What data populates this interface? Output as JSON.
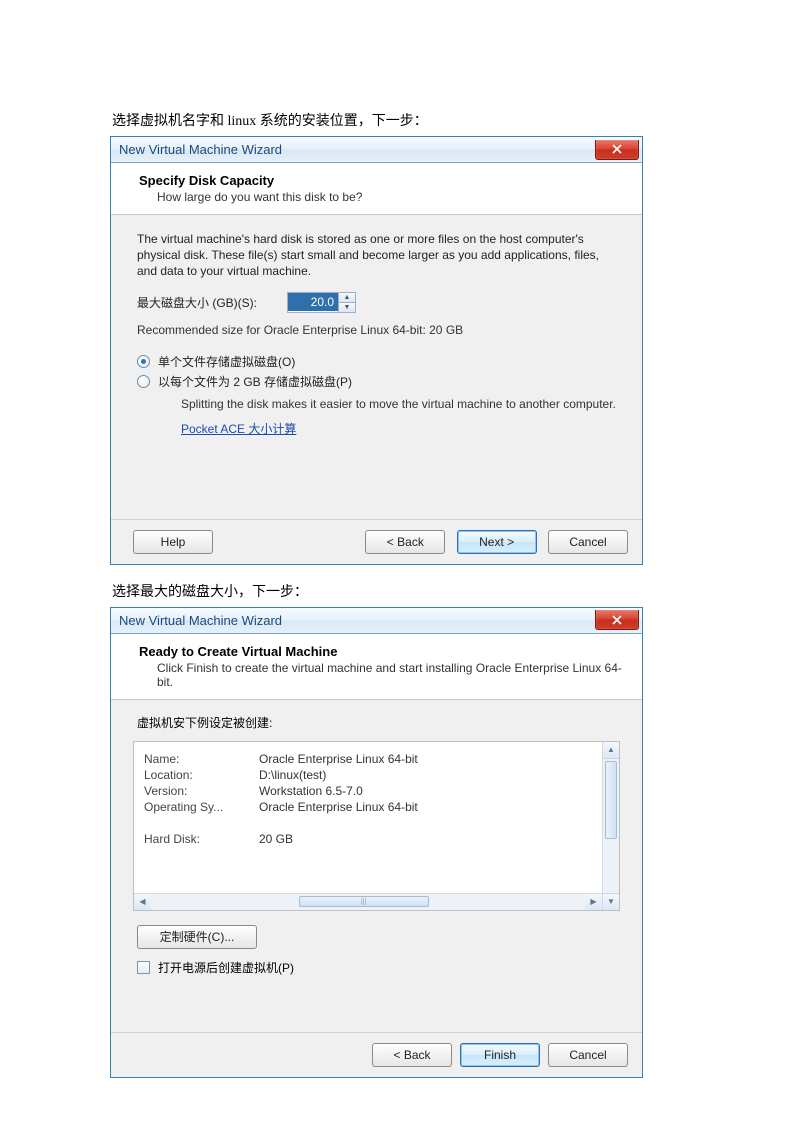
{
  "caption1": "选择虚拟机名字和 linux 系统的安装位置，下一步：",
  "caption2": "选择最大的磁盘大小，下一步：",
  "dialog1": {
    "title": "New Virtual Machine Wizard",
    "header_title": "Specify Disk Capacity",
    "header_sub": "How large do you want this disk to be?",
    "desc": "The virtual machine's hard disk is stored as one or more files on the host computer's physical disk. These file(s) start small and become larger as you add applications, files, and data to your virtual machine.",
    "disk_size_label": "最大磁盘大小 (GB)(S):",
    "disk_size_value": "20.0",
    "recommended": "Recommended size for Oracle Enterprise Linux 64-bit: 20 GB",
    "radio1": "单个文件存储虚拟磁盘(O)",
    "radio2": "以每个文件为 2 GB 存储虚拟磁盘(P)",
    "split_desc": "Splitting the disk makes it easier to move the virtual machine to another computer.",
    "link": "Pocket ACE 大小计算",
    "buttons": {
      "help": "Help",
      "back": "< Back",
      "next": "Next >",
      "cancel": "Cancel"
    }
  },
  "dialog2": {
    "title": "New Virtual Machine Wizard",
    "header_title": "Ready to Create Virtual Machine",
    "header_sub": "Click Finish to create the virtual machine and start installing Oracle Enterprise Linux 64-bit.",
    "summary_label": "虚拟机安下例设定被创建:",
    "rows": [
      {
        "k": "Name:",
        "v": "Oracle Enterprise Linux 64-bit"
      },
      {
        "k": "Location:",
        "v": "D:\\linux(test)"
      },
      {
        "k": "Version:",
        "v": "Workstation 6.5-7.0"
      },
      {
        "k": "Operating Sy...",
        "v": "Oracle Enterprise Linux 64-bit"
      }
    ],
    "extra_row": {
      "k": "Hard Disk:",
      "v": "20 GB"
    },
    "customize": "定制硬件(C)...",
    "poweron_chk": "打开电源后创建虚拟机(P)",
    "buttons": {
      "back": "< Back",
      "finish": "Finish",
      "cancel": "Cancel"
    }
  }
}
